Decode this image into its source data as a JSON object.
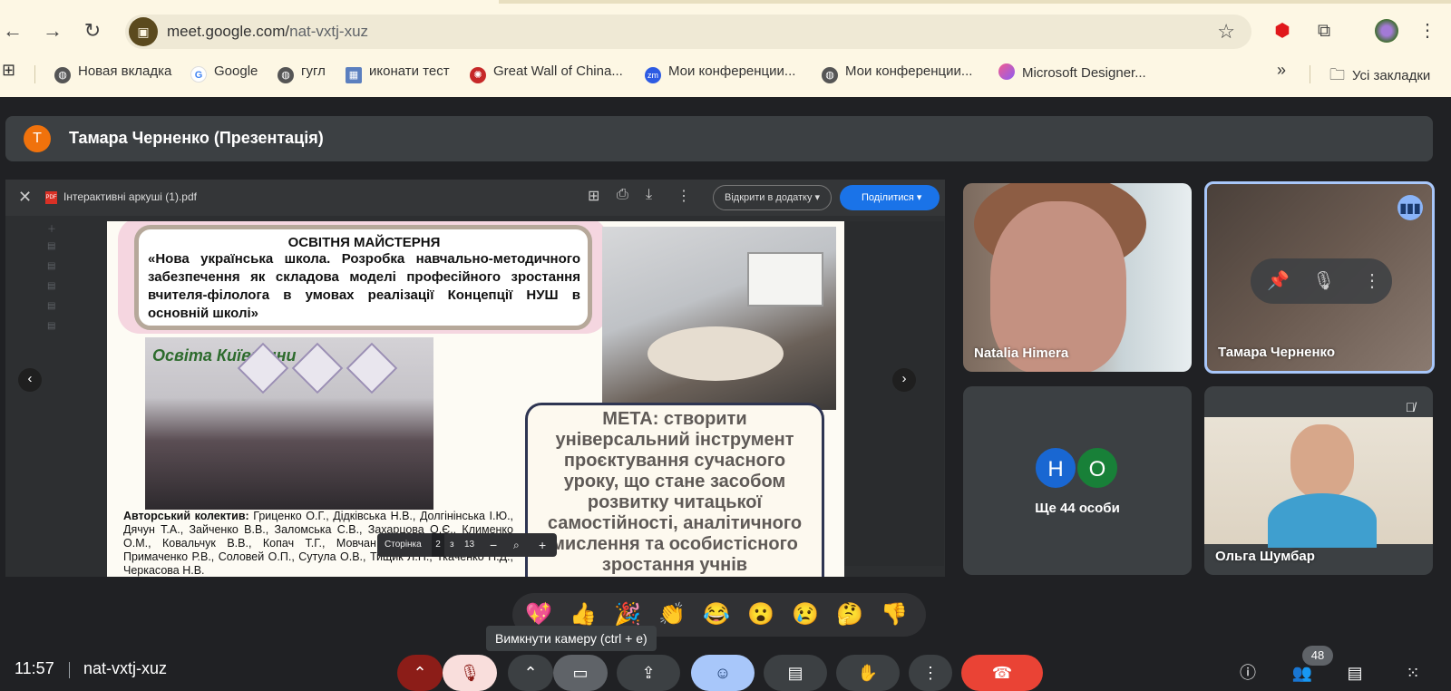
{
  "browser": {
    "url_domain": "meet.google.com/",
    "url_path": "nat-vxtj-xuz",
    "bookmarks": [
      {
        "label": "Новая вкладка",
        "icon": "globe-icon"
      },
      {
        "label": "Google",
        "icon": "google-icon"
      },
      {
        "label": "гугл",
        "icon": "globe-icon"
      },
      {
        "label": "иконати тест",
        "icon": "site-icon"
      },
      {
        "label": "Great Wall of China...",
        "icon": "site-icon"
      },
      {
        "label": "Мои конференции...",
        "icon": "zoom-icon"
      },
      {
        "label": "Мои конференции...",
        "icon": "globe-icon"
      },
      {
        "label": "Microsoft Designer...",
        "icon": "designer-icon"
      }
    ],
    "all_bookmarks": "Усі закладки",
    "chevron": "»"
  },
  "presenter": {
    "initial": "T",
    "name": "Тамара Черненко (Презентація)"
  },
  "share": {
    "file_name": "Інтерактивні аркуші (1).pdf",
    "open_in": "Відкрити в додатку",
    "share_label": "Поділитися",
    "page_label": "Сторінка",
    "page_current": "2",
    "page_sep": "з",
    "page_total": "13"
  },
  "slide": {
    "title": "ОСВІТНЯ МАЙСТЕРНЯ",
    "subtitle": "«Нова українська школа. Розробка навчально-методичного забезпечення як складова моделі професійного зростання вчителя-філолога в умовах реалізації Концепції НУШ в основній школі»",
    "logo": "Освіта Київщини",
    "meta": "МЕТА: створити універсальний інструмент проєктування сучасного уроку, що стане засобом розвитку читацької самостійності, аналітичного мислення та особистісного зростання учнів",
    "authors_label": "Авторський колектив:",
    "authors": " Гриценко О.Г., Дідківська Н.В., Долгінінська І.Ю., Дячун Т.А., Зайченко В.В., Заломська С.В., Захарцова О.Є., Клименко О.М., Ковальчук В.В., Копач Т.Г., Мовчан Н.М., Почерніна І.М., Примаченко Р.В., Соловей О.П., Сутула О.В., Тищик Л.П., Ткаченко Н.Д., Черкасова Н.В."
  },
  "participants": {
    "natalia": "Natalia Himera",
    "tamara": "Тамара Черненко",
    "avatar_h": "Н",
    "avatar_o": "О",
    "more_label": "Ще 44 особи",
    "olga": "Ольга Шумбар"
  },
  "reactions": [
    "💖",
    "👍",
    "🎉",
    "👏",
    "😂",
    "😮",
    "😢",
    "🤔",
    "👎"
  ],
  "tooltip": "Вимкнути камеру (ctrl + e)",
  "bottom": {
    "time": "11:57",
    "meeting_code": "nat-vxtj-xuz",
    "people_count": "48"
  },
  "colors": {
    "meet_bg": "#202124",
    "browser_bg": "#fdf7e4",
    "accent_blue": "#1a73e8",
    "end_call_red": "#ea4335"
  }
}
